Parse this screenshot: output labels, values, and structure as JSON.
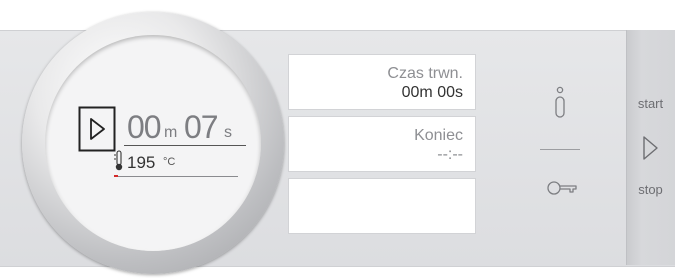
{
  "timer": {
    "label": "Czas trwn.",
    "value": "00m 00s"
  },
  "end": {
    "label": "Koniec",
    "value": "--:--"
  },
  "dial": {
    "minutes": "00",
    "min_unit": "m",
    "seconds": "07",
    "sec_unit": "s",
    "temperature": "195",
    "temp_unit": "°C"
  },
  "controls": {
    "start_label": "start",
    "stop_label": "stop"
  },
  "colors": {
    "accent_red": "#d42a2a",
    "panel_grey": "#e1e2e5"
  },
  "icons": {
    "play": "play-icon",
    "info": "info-icon",
    "key": "key-icon",
    "thermometer": "thermometer-icon"
  }
}
